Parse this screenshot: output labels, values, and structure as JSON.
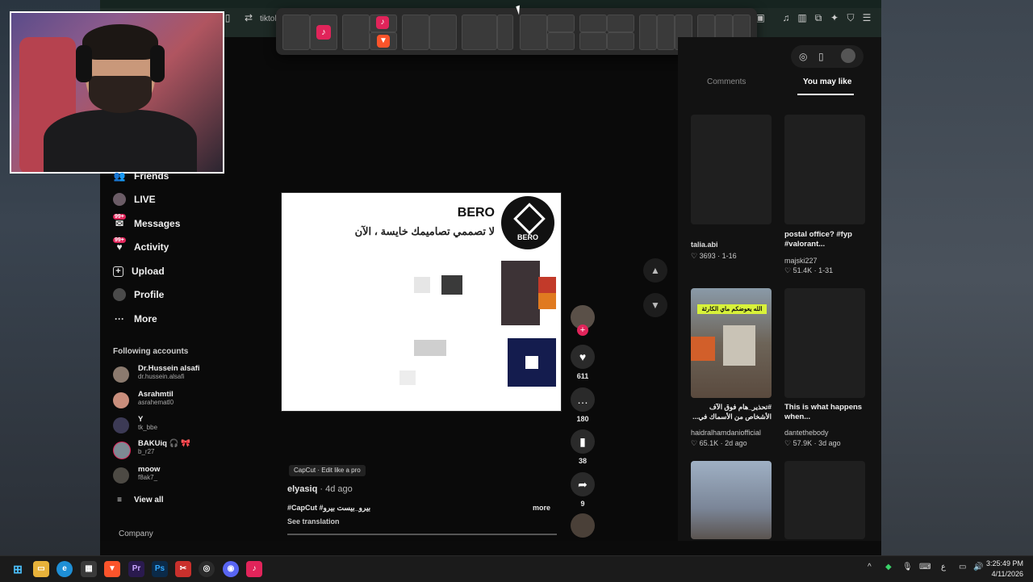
{
  "browser": {
    "url_text": "tiktok",
    "toolbar_icons": [
      "music-icon",
      "sidebar-icon",
      "split-icon",
      "extensions-icon",
      "favorites-icon",
      "shield-icon",
      "menu-icon"
    ]
  },
  "sidebar": {
    "nav": [
      {
        "label": "Friends",
        "icon": "friends-icon"
      },
      {
        "label": "LIVE",
        "icon": "live-icon"
      },
      {
        "label": "Messages",
        "icon": "messages-icon",
        "badge": "99+"
      },
      {
        "label": "Activity",
        "icon": "activity-icon",
        "badge": "99+"
      },
      {
        "label": "Upload",
        "icon": "upload-icon"
      },
      {
        "label": "Profile",
        "icon": "profile-icon"
      },
      {
        "label": "More",
        "icon": "more-icon"
      }
    ],
    "following_title": "Following accounts",
    "accounts": [
      {
        "name": "Dr.Hussein alsafi",
        "handle": "dr.hussein.alsafi"
      },
      {
        "name": "Asrahmtil",
        "handle": "asrahematl0"
      },
      {
        "name": "Y",
        "handle": "tk_bbe"
      },
      {
        "name": "BAKUiq 🎧 🎀",
        "handle": "b_r27"
      },
      {
        "name": "moow",
        "handle": "f8ak7_"
      }
    ],
    "view_all": "View all",
    "company": "Company"
  },
  "video": {
    "title": "BERO",
    "subtitle": "لا تصممي تصاميمك خايسة ، الآن",
    "logo_text": "BERO",
    "capcut_label": "CapCut · Edit like a pro",
    "author": "elyasiq",
    "date": "4d ago",
    "hashtags": "#CapCut #بيرو_بيست بيرو",
    "see_translation": "See translation",
    "more": "more"
  },
  "actions": {
    "likes": "611",
    "comments": "180",
    "saves": "38",
    "shares": "9"
  },
  "right_panel": {
    "tab_comments": "Comments",
    "tab_you_may_like": "You may like",
    "cards": [
      {
        "title": "",
        "author": "talia.abi",
        "likes": "3693",
        "date": "1-16"
      },
      {
        "title": "postal office? #fyp #valorant...",
        "author": "majski227",
        "likes": "51.4K",
        "date": "1-31"
      },
      {
        "title": "#تحذير_هام فوق الآف الأشخاص من الأسماك في...",
        "author": "haidralhamdaniofficial",
        "likes": "65.1K",
        "date": "2d ago",
        "thumb_text": "الله يعوضكم ماي الكارثة"
      },
      {
        "title": "This is what happens when...",
        "author": "dantethebody",
        "likes": "57.9K",
        "date": "3d ago"
      }
    ]
  },
  "taskbar": {
    "apps": [
      "start-icon",
      "file-explorer-icon",
      "edge-icon",
      "store-icon",
      "brave-icon",
      "premiere-icon",
      "photoshop-icon",
      "snipping-icon",
      "chrome-icon",
      "discord-icon",
      "tiktok-icon"
    ],
    "time": "3:25:49 PM",
    "date": "4/11/2026",
    "lang": "ع"
  },
  "colors": {
    "tiktok_red": "#e1245a",
    "panel_bg": "#121212",
    "browser_bar": "#1e2a26"
  }
}
